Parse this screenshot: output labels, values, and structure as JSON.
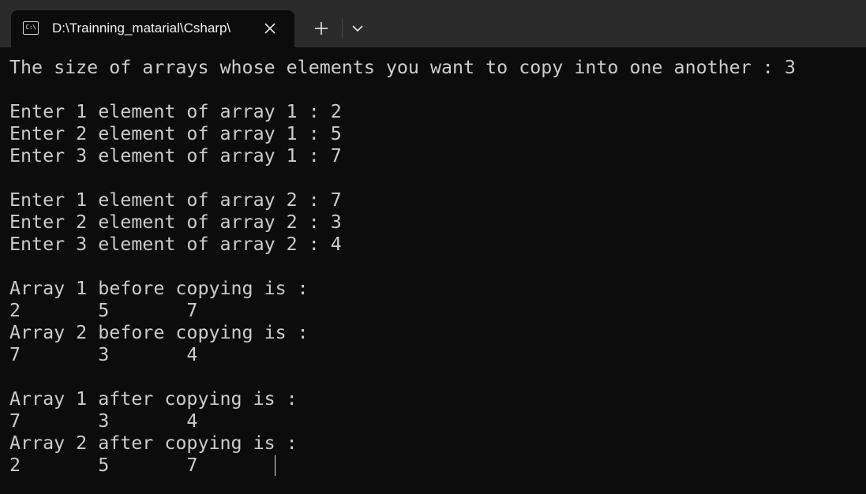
{
  "tab": {
    "icon_glyph": "C:\\",
    "title": "D:\\Trainning_matarial\\Csharp\\"
  },
  "terminal": {
    "lines": [
      "The size of arrays whose elements you want to copy into one another : 3",
      "",
      "Enter 1 element of array 1 : 2",
      "Enter 2 element of array 1 : 5",
      "Enter 3 element of array 1 : 7",
      "",
      "Enter 1 element of array 2 : 7",
      "Enter 2 element of array 2 : 3",
      "Enter 3 element of array 2 : 4",
      "",
      "Array 1 before copying is :",
      "2       5       7",
      "Array 2 before copying is :",
      "7       3       4",
      "",
      "Array 1 after copying is :",
      "7       3       4",
      "Array 2 after copying is :",
      "2       5       7"
    ]
  },
  "colors": {
    "terminal_bg": "#0c0c0c",
    "titlebar_bg": "#2b2b2b",
    "text": "#cccccc"
  },
  "icons": {
    "close": "close-icon",
    "new_tab": "plus-icon",
    "dropdown": "chevron-down-icon"
  }
}
